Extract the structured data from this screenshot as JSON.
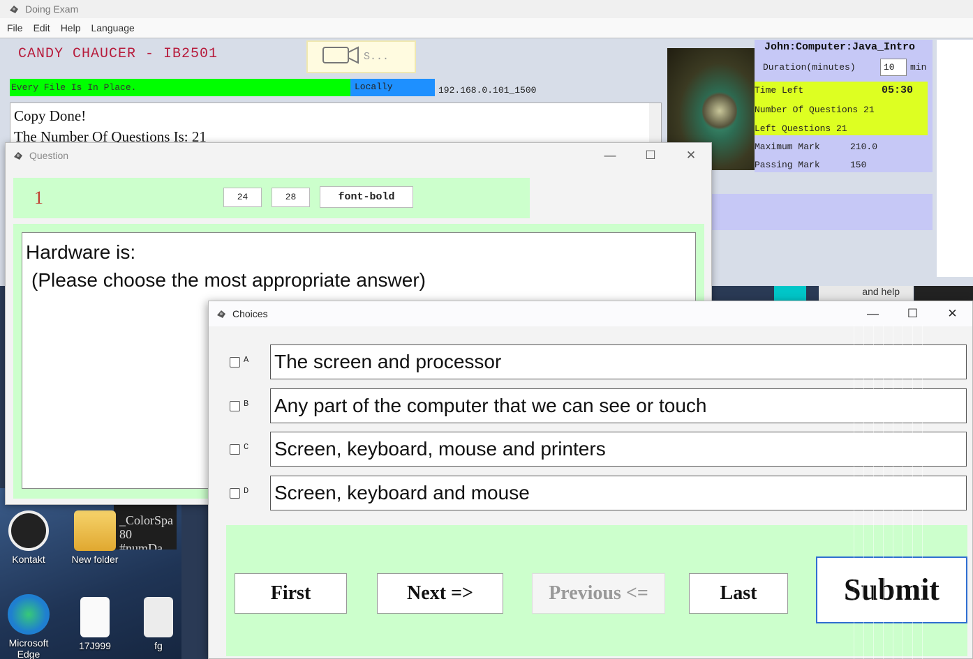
{
  "main": {
    "title": "Doing Exam",
    "menu": [
      "File",
      "Edit",
      "Help",
      "Language"
    ],
    "candidate": "CANDY CHAUCER - IB2501",
    "camera_label": "S...",
    "status": "Every File Is In Place.",
    "mode": "Locally",
    "ip": "192.168.0.101_1500",
    "log": [
      "Copy Done!",
      "The Number Of Questions Is: 21"
    ]
  },
  "info": {
    "exam": "John:Computer:Java_Intro",
    "duration_label": "Duration(minutes)",
    "duration_value": "10",
    "duration_unit": "min",
    "time_left_label": "Time Left",
    "time_left_value": "05:30",
    "num_questions": "Number Of Questions 21",
    "left_questions": "Left Questions 21",
    "max_mark_label": "Maximum Mark",
    "max_mark_value": "210.0",
    "pass_mark_label": "Passing Mark",
    "pass_mark_value": "150"
  },
  "strip": {
    "text": "and help"
  },
  "question_window": {
    "title": "Question",
    "number": "1",
    "size_a": "24",
    "size_b": "28",
    "font_btn": "font-bold",
    "text_line1": "Hardware is:",
    "text_line2": "(Please choose the most appropriate answer)"
  },
  "choices_window": {
    "title": "Choices",
    "choices": [
      {
        "label": "A",
        "text": "The screen and processor"
      },
      {
        "label": "B",
        "text": "Any part of the computer that we can see or touch"
      },
      {
        "label": "C",
        "text": "Screen, keyboard, mouse and printers"
      },
      {
        "label": "D",
        "text": "Screen, keyboard and mouse"
      }
    ],
    "nav": {
      "first": "First",
      "next": "Next =>",
      "previous": "Previous <=",
      "last": "Last",
      "submit": "Submit"
    }
  },
  "desktop": {
    "icons": [
      "Kontakt",
      "New folder",
      "Microsoft Edge",
      "17J999",
      "fg"
    ],
    "fragment": [
      "_ColorSpa",
      "80 #numDa"
    ]
  },
  "colors": {
    "accent_green": "#ccffcc",
    "status_green": "#00ff00",
    "mode_blue": "#1e90ff",
    "info_purple": "#c6c8f6",
    "timer_yellow": "#ddff22",
    "name_red": "#b71c3c"
  }
}
